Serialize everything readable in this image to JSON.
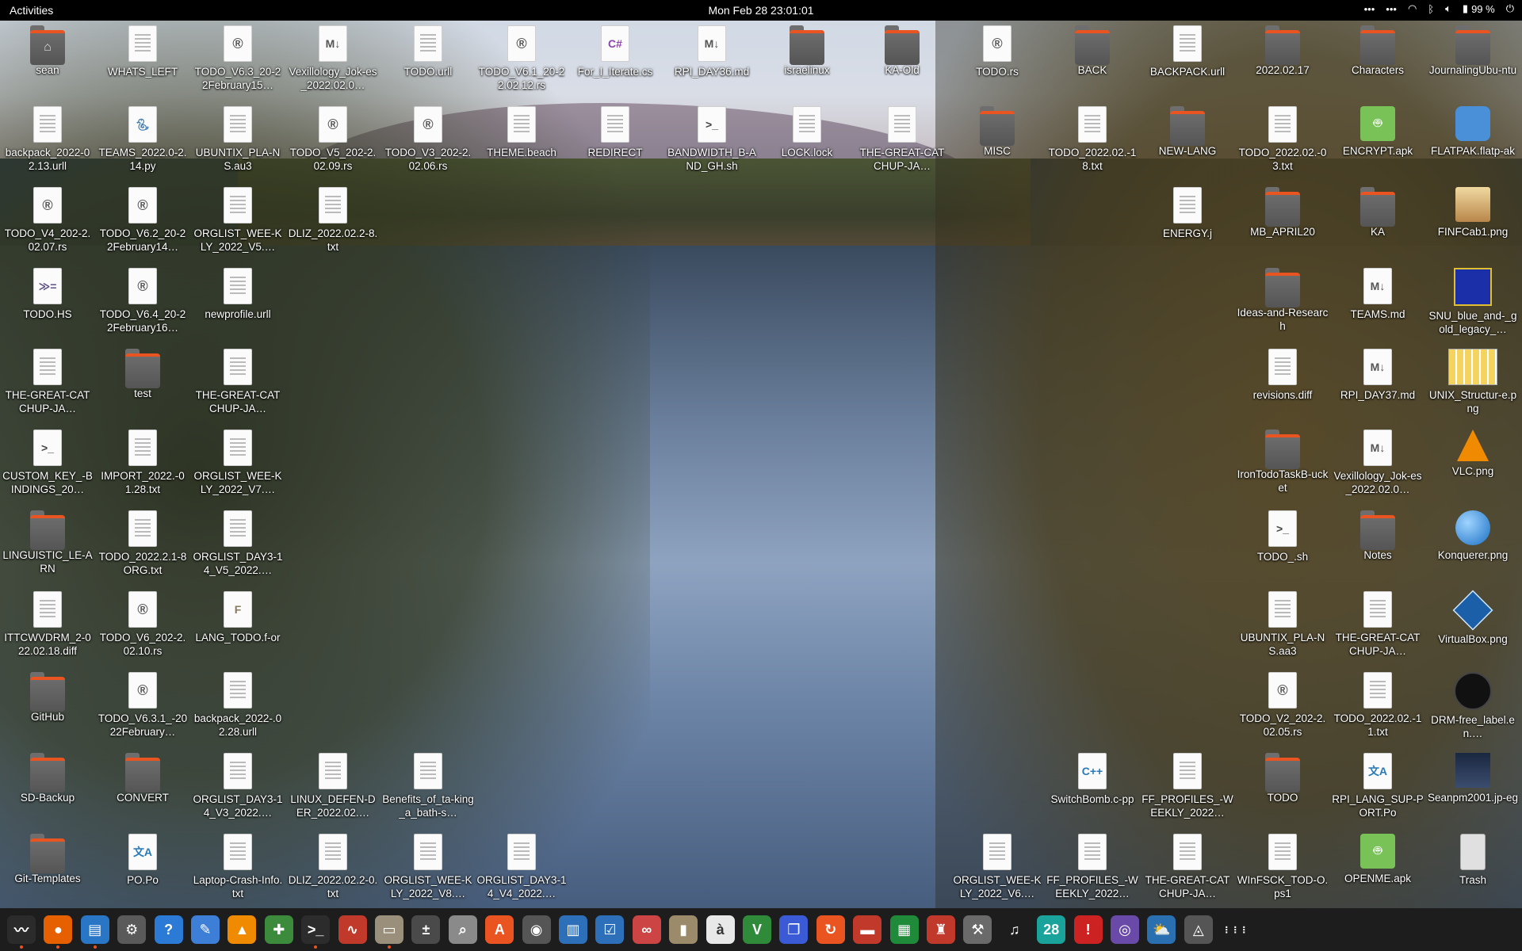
{
  "topbar": {
    "activities": "Activities",
    "clock": "Mon Feb 28  23:01:01",
    "battery": "99 %"
  },
  "desktop_icons": [
    {
      "label": "sean",
      "type": "folder-home"
    },
    {
      "label": "WHATS_LEFT",
      "type": "doc"
    },
    {
      "label": "TODO_V6.3_20-22February15…",
      "type": "rust"
    },
    {
      "label": "Vexillology_Jok-es_2022.02.0…",
      "type": "md"
    },
    {
      "label": "TODO.urll",
      "type": "doc"
    },
    {
      "label": "TODO_V6.1_20-22.02.12.rs",
      "type": "rust"
    },
    {
      "label": "For_I_Iterate.cs",
      "type": "cs"
    },
    {
      "label": "RPI_DAY36.md",
      "type": "md"
    },
    {
      "label": "israelinux",
      "type": "folder"
    },
    {
      "label": "KA-Old",
      "type": "folder"
    },
    {
      "label": "TODO.rs",
      "type": "rust"
    },
    {
      "label": "BACK",
      "type": "folder"
    },
    {
      "label": "BACKPACK.urll",
      "type": "doc"
    },
    {
      "label": "2022.02.17",
      "type": "folder"
    },
    {
      "label": "Characters",
      "type": "folder"
    },
    {
      "label": "JournalingUbu-ntu",
      "type": "folder"
    },
    {
      "label": "backpack_2022-02.13.urll",
      "type": "doc"
    },
    {
      "label": "TEAMS_2022.0-2.14.py",
      "type": "py"
    },
    {
      "label": "UBUNTIX_PLA-NS.au3",
      "type": "doc"
    },
    {
      "label": "TODO_V5_202-2.02.09.rs",
      "type": "rust"
    },
    {
      "label": "TODO_V3_202-2.02.06.rs",
      "type": "rust"
    },
    {
      "label": "THEME.beach",
      "type": "doc"
    },
    {
      "label": "REDIRECT",
      "type": "doc"
    },
    {
      "label": "BANDWIDTH_B-AND_GH.sh",
      "type": "sh"
    },
    {
      "label": "LOCK.lock",
      "type": "doc"
    },
    {
      "label": "THE-GREAT-CATCHUP-JA…",
      "type": "doc"
    },
    {
      "label": "MISC",
      "type": "folder"
    },
    {
      "label": "TODO_2022.02.-18.txt",
      "type": "doc"
    },
    {
      "label": "NEW-LANG",
      "type": "folder"
    },
    {
      "label": "TODO_2022.02.-03.txt",
      "type": "doc"
    },
    {
      "label": "ENCRYPT.apk",
      "type": "apk"
    },
    {
      "label": "FLATPAK.flatp-ak",
      "type": "flatpak"
    },
    {
      "label": "TODO_V4_202-2.02.07.rs",
      "type": "rust"
    },
    {
      "label": "TODO_V6.2_20-22February14…",
      "type": "rust"
    },
    {
      "label": "ORGLIST_WEE-KLY_2022_V5.…",
      "type": "doc"
    },
    {
      "label": "DLIZ_2022.02.2-8.txt",
      "type": "doc"
    },
    {
      "label": "ENERGY.j",
      "type": "doc"
    },
    {
      "label": "MB_APRIL20",
      "type": "folder"
    },
    {
      "label": "KA",
      "type": "folder"
    },
    {
      "label": "FINFCab1.png",
      "type": "img-cabinet"
    },
    {
      "label": "TODO.HS",
      "type": "hs"
    },
    {
      "label": "TODO_V6.4_20-22February16…",
      "type": "rust"
    },
    {
      "label": "newprofile.urll",
      "type": "doc"
    },
    {
      "label": "Ideas-and-Research",
      "type": "folder"
    },
    {
      "label": "TEAMS.md",
      "type": "md"
    },
    {
      "label": "SNU_blue_and-_gold_legacy_…",
      "type": "img-snu"
    },
    {
      "label": "THE-GREAT-CATCHUP-JA…",
      "type": "doc"
    },
    {
      "label": "test",
      "type": "folder"
    },
    {
      "label": "THE-GREAT-CATCHUP-JA…",
      "type": "doc"
    },
    {
      "label": "revisions.diff",
      "type": "doc"
    },
    {
      "label": "RPI_DAY37.md",
      "type": "md"
    },
    {
      "label": "UNIX_Structur-e.png",
      "type": "img-unix"
    },
    {
      "label": "CUSTOM_KEY_-BINDINGS_20…",
      "type": "sh"
    },
    {
      "label": "IMPORT_2022.-01.28.txt",
      "type": "doc"
    },
    {
      "label": "ORGLIST_WEE-KLY_2022_V7.…",
      "type": "doc"
    },
    {
      "label": "IronTodoTaskB-ucket",
      "type": "folder"
    },
    {
      "label": "Vexillology_Jok-es_2022.02.0…",
      "type": "md"
    },
    {
      "label": "VLC.png",
      "type": "img-vlc"
    },
    {
      "label": "LINGUISTIC_LE-ARN",
      "type": "folder"
    },
    {
      "label": "TODO_2022.2.1-8ORG.txt",
      "type": "doc"
    },
    {
      "label": "ORGLIST_DAY3-14_V5_2022.…",
      "type": "doc"
    },
    {
      "label": "TODO_.sh",
      "type": "sh"
    },
    {
      "label": "Notes",
      "type": "folder"
    },
    {
      "label": "Konquerer.png",
      "type": "img-konq"
    },
    {
      "label": "ITTCWVDRM_2-022.02.18.diff",
      "type": "doc"
    },
    {
      "label": "TODO_V6_202-2.02.10.rs",
      "type": "rust"
    },
    {
      "label": "LANG_TODO.f-or",
      "type": "for"
    },
    {
      "label": "UBUNTIX_PLA-NS.aa3",
      "type": "doc"
    },
    {
      "label": "THE-GREAT-CATCHUP-JA…",
      "type": "doc"
    },
    {
      "label": "VirtualBox.png",
      "type": "img-vbox"
    },
    {
      "label": "GitHub",
      "type": "folder"
    },
    {
      "label": "TODO_V6.3.1_-2022February…",
      "type": "rust"
    },
    {
      "label": "backpack_2022-.02.28.urll",
      "type": "doc"
    },
    {
      "label": "TODO_V2_202-2.02.05.rs",
      "type": "rust"
    },
    {
      "label": "TODO_2022.02.-11.txt",
      "type": "doc"
    },
    {
      "label": "DRM-free_label.en.…",
      "type": "img-drm"
    },
    {
      "label": "SD-Backup",
      "type": "folder"
    },
    {
      "label": "CONVERT",
      "type": "folder"
    },
    {
      "label": "ORGLIST_DAY3-14_V3_2022.…",
      "type": "doc"
    },
    {
      "label": "LINUX_DEFEN-DER_2022.02.…",
      "type": "doc"
    },
    {
      "label": "Benefits_of_ta-king_a_bath-s…",
      "type": "doc"
    },
    {
      "label": "SwitchBomb.c-pp",
      "type": "cpp"
    },
    {
      "label": "FF_PROFILES_-WEEKLY_2022…",
      "type": "doc"
    },
    {
      "label": "TODO",
      "type": "folder"
    },
    {
      "label": "RPI_LANG_SUP-PORT.Po",
      "type": "po"
    },
    {
      "label": "Seanpm2001.jp-eg",
      "type": "img-photo"
    },
    {
      "label": "Git-Templates",
      "type": "folder"
    },
    {
      "label": "PO.Po",
      "type": "po"
    },
    {
      "label": "Laptop-Crash-Info.txt",
      "type": "doc"
    },
    {
      "label": "DLIZ_2022.02.2-0.txt",
      "type": "doc"
    },
    {
      "label": "ORGLIST_WEE-KLY_2022_V8.…",
      "type": "doc"
    },
    {
      "label": "ORGLIST_DAY3-14_V4_2022.…",
      "type": "doc"
    },
    {
      "label": "ORGLIST_WEE-KLY_2022_V6.…",
      "type": "doc"
    },
    {
      "label": "FF_PROFILES_-WEEKLY_2022…",
      "type": "doc"
    },
    {
      "label": "THE-GREAT-CATCHUP-JA…",
      "type": "doc"
    },
    {
      "label": "WInFSCK_TOD-O.ps1",
      "type": "doc"
    },
    {
      "label": "OPENME.apk",
      "type": "apk"
    },
    {
      "label": "Trash",
      "type": "trash"
    }
  ],
  "dock": [
    {
      "name": "system-monitor",
      "glyph": "〰",
      "color": "#2b2b2b"
    },
    {
      "name": "firefox",
      "glyph": "●",
      "color": "#e66000"
    },
    {
      "name": "text-document-viewer",
      "glyph": "▤",
      "color": "#2a76c6"
    },
    {
      "name": "settings",
      "glyph": "⚙",
      "color": "#5a5a5a"
    },
    {
      "name": "help",
      "glyph": "?",
      "color": "#2b7bd6"
    },
    {
      "name": "text-editor",
      "glyph": "✎",
      "color": "#3d7fd6"
    },
    {
      "name": "vlc",
      "glyph": "▲",
      "color": "#f08a00"
    },
    {
      "name": "puzzle",
      "glyph": "✚",
      "color": "#3c8a3c"
    },
    {
      "name": "terminal",
      "glyph": ">_",
      "color": "#2c2c2c"
    },
    {
      "name": "system-monitor-graph",
      "glyph": "∿",
      "color": "#c0392b"
    },
    {
      "name": "files",
      "glyph": "▭",
      "color": "#9a8f7a"
    },
    {
      "name": "calculator",
      "glyph": "±",
      "color": "#4a4a4a"
    },
    {
      "name": "image-viewer",
      "glyph": "⌕",
      "color": "#8a8a8a"
    },
    {
      "name": "software-center",
      "glyph": "A",
      "color": "#e95420"
    },
    {
      "name": "disk-utility",
      "glyph": "◉",
      "color": "#555555"
    },
    {
      "name": "bookshelf",
      "glyph": "▥",
      "color": "#2d6fb8"
    },
    {
      "name": "task-list",
      "glyph": "☑",
      "color": "#2d6fb8"
    },
    {
      "name": "glasses",
      "glyph": "∞",
      "color": "#cc4444"
    },
    {
      "name": "archive-manager",
      "glyph": "▮",
      "color": "#9b8b6a"
    },
    {
      "name": "character-map",
      "glyph": "à",
      "color": "#e8e8e8"
    },
    {
      "name": "vim",
      "glyph": "V",
      "color": "#2f8a3a"
    },
    {
      "name": "window-switcher",
      "glyph": "❐",
      "color": "#3b5bd6"
    },
    {
      "name": "software-updater",
      "glyph": "↻",
      "color": "#e95420"
    },
    {
      "name": "document-viewer",
      "glyph": "▬",
      "color": "#c0392b"
    },
    {
      "name": "spreadsheet",
      "glyph": "▦",
      "color": "#1e8a3a"
    },
    {
      "name": "mario-game",
      "glyph": "♜",
      "color": "#c0392b"
    },
    {
      "name": "tools",
      "glyph": "⚒",
      "color": "#6a6a6a"
    },
    {
      "name": "music",
      "glyph": "♫",
      "color": "#1d1d1d"
    },
    {
      "name": "calendar",
      "glyph": "28",
      "color": "#1aa39a"
    },
    {
      "name": "error-reporter",
      "glyph": "!",
      "color": "#cc2222"
    },
    {
      "name": "screenshot",
      "glyph": "◎",
      "color": "#6a4aa8"
    },
    {
      "name": "weather",
      "glyph": "⛅",
      "color": "#2a6fb0"
    },
    {
      "name": "ubuntu-installer",
      "glyph": "◬",
      "color": "#555555"
    },
    {
      "name": "show-applications",
      "glyph": "⋮⋮⋮",
      "color": "#1d1d1d"
    }
  ]
}
